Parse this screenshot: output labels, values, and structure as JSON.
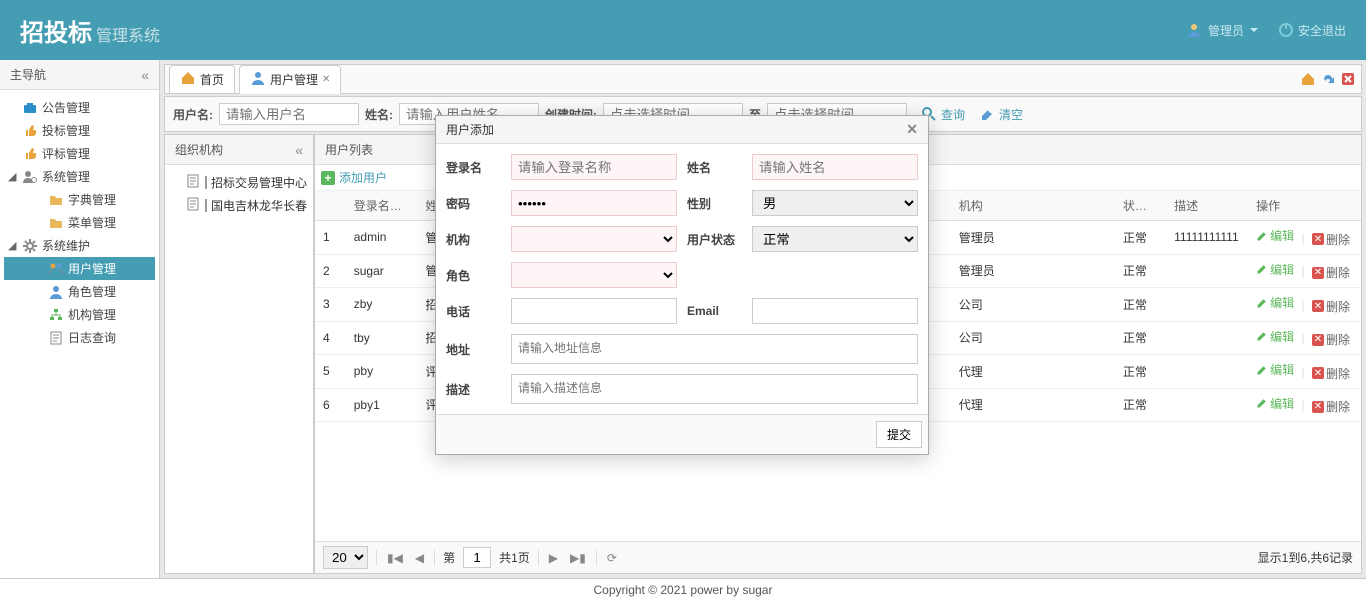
{
  "header": {
    "logo_main": "招投标",
    "logo_sub": "管理系统",
    "user_label": "管理员",
    "exit_label": "安全退出"
  },
  "sidebar": {
    "title": "主导航",
    "nav": [
      {
        "label": "公告管理",
        "level": 1,
        "icon": "briefcase",
        "color": "#2a8ecb"
      },
      {
        "label": "投标管理",
        "level": 1,
        "icon": "thumb-up",
        "color": "#e8a33d"
      },
      {
        "label": "评标管理",
        "level": 1,
        "icon": "thumb-up",
        "color": "#e8a33d"
      },
      {
        "label": "系统管理",
        "level": 1,
        "icon": "user-gear",
        "color": "#888",
        "expanded": true,
        "children": [
          {
            "label": "字典管理",
            "level": 2,
            "icon": "folder",
            "color": "#e8b85a"
          },
          {
            "label": "菜单管理",
            "level": 2,
            "icon": "folder",
            "color": "#e8b85a"
          }
        ]
      },
      {
        "label": "系统维护",
        "level": 1,
        "icon": "gear",
        "color": "#888",
        "expanded": true,
        "children": [
          {
            "label": "用户管理",
            "level": 2,
            "icon": "users",
            "selected": true
          },
          {
            "label": "角色管理",
            "level": 2,
            "icon": "user",
            "color": "#5a9bd5"
          },
          {
            "label": "机构管理",
            "level": 2,
            "icon": "org",
            "color": "#5cb85c"
          },
          {
            "label": "日志查询",
            "level": 2,
            "icon": "page",
            "color": "#888"
          }
        ]
      }
    ]
  },
  "tabs": {
    "items": [
      {
        "label": "首页",
        "icon": "home",
        "closable": false
      },
      {
        "label": "用户管理",
        "icon": "user",
        "closable": true,
        "active": true
      }
    ]
  },
  "search": {
    "user_label": "用户名:",
    "user_placeholder": "请输入用户名",
    "name_label": "姓名:",
    "name_placeholder": "请输入用户姓名",
    "created_label": "创建时间:",
    "date_placeholder": "点击选择时间",
    "to_label": "至",
    "query": "查询",
    "clear": "清空"
  },
  "org_panel": {
    "title": "组织机构",
    "items": [
      {
        "label": "招标交易管理中心"
      },
      {
        "label": "国电吉林龙华长春"
      }
    ]
  },
  "grid_panel": {
    "title": "用户列表",
    "add_label": "添加用户",
    "columns": {
      "login": "登录名",
      "name": "姓名",
      "status": "状态",
      "org": "机构",
      "desc": "描述",
      "ops": "操作"
    },
    "rows": [
      {
        "idx": 1,
        "login": "admin",
        "name": "管",
        "org": "管理员",
        "status": "正常",
        "desc": "11111111111"
      },
      {
        "idx": 2,
        "login": "sugar",
        "name": "管",
        "org": "管理员",
        "status": "正常",
        "desc": ""
      },
      {
        "idx": 3,
        "login": "zby",
        "name": "招",
        "org": "公司",
        "status": "正常",
        "desc": ""
      },
      {
        "idx": 4,
        "login": "tby",
        "name": "招",
        "org": "公司",
        "status": "正常",
        "desc": ""
      },
      {
        "idx": 5,
        "login": "pby",
        "name": "评",
        "org": "代理",
        "status": "正常",
        "desc": ""
      },
      {
        "idx": 6,
        "login": "pby1",
        "name": "评",
        "org": "代理",
        "status": "正常",
        "desc": ""
      }
    ],
    "op_edit": "编辑",
    "op_delete": "删除"
  },
  "pager": {
    "size": "20",
    "page_prefix": "第",
    "page_value": "1",
    "page_suffix": "共1页",
    "display": "显示1到6,共6记录"
  },
  "modal": {
    "title": "用户添加",
    "fields": {
      "login": "登录名",
      "login_ph": "请输入登录名称",
      "name": "姓名",
      "name_ph": "请输入姓名",
      "pwd": "密码",
      "pwd_val": "••••••",
      "sex": "性别",
      "sex_val": "男",
      "org": "机构",
      "state": "用户状态",
      "state_val": "正常",
      "role": "角色",
      "tel": "电话",
      "email": "Email",
      "addr": "地址",
      "addr_ph": "请输入地址信息",
      "desc": "描述",
      "desc_ph": "请输入描述信息"
    },
    "submit": "提交"
  },
  "footer": "Copyright © 2021 power by sugar"
}
